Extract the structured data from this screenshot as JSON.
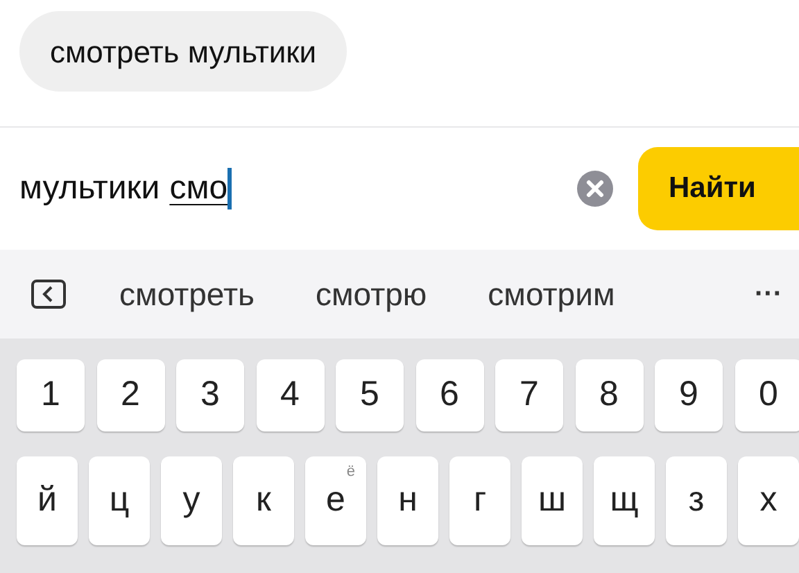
{
  "chips": [
    {
      "label": "смотреть мультики"
    }
  ],
  "search": {
    "value": "мультики",
    "composing": "смо",
    "focused": true,
    "submit": "Найти"
  },
  "suggestions": [
    "смотреть",
    "смотрю",
    "смотрим"
  ],
  "more": "···",
  "keyboard": {
    "number_row": [
      {
        "label": "1"
      },
      {
        "label": "2"
      },
      {
        "label": "3"
      },
      {
        "label": "4"
      },
      {
        "label": "5"
      },
      {
        "label": "6"
      },
      {
        "label": "7"
      },
      {
        "label": "8"
      },
      {
        "label": "9"
      },
      {
        "label": "0"
      }
    ],
    "letter_row": [
      {
        "label": "й"
      },
      {
        "label": "ц"
      },
      {
        "label": "у"
      },
      {
        "label": "к"
      },
      {
        "label": "е",
        "alt": "ё"
      },
      {
        "label": "н"
      },
      {
        "label": "г"
      },
      {
        "label": "ш"
      },
      {
        "label": "щ"
      },
      {
        "label": "з"
      },
      {
        "label": "х"
      }
    ]
  }
}
